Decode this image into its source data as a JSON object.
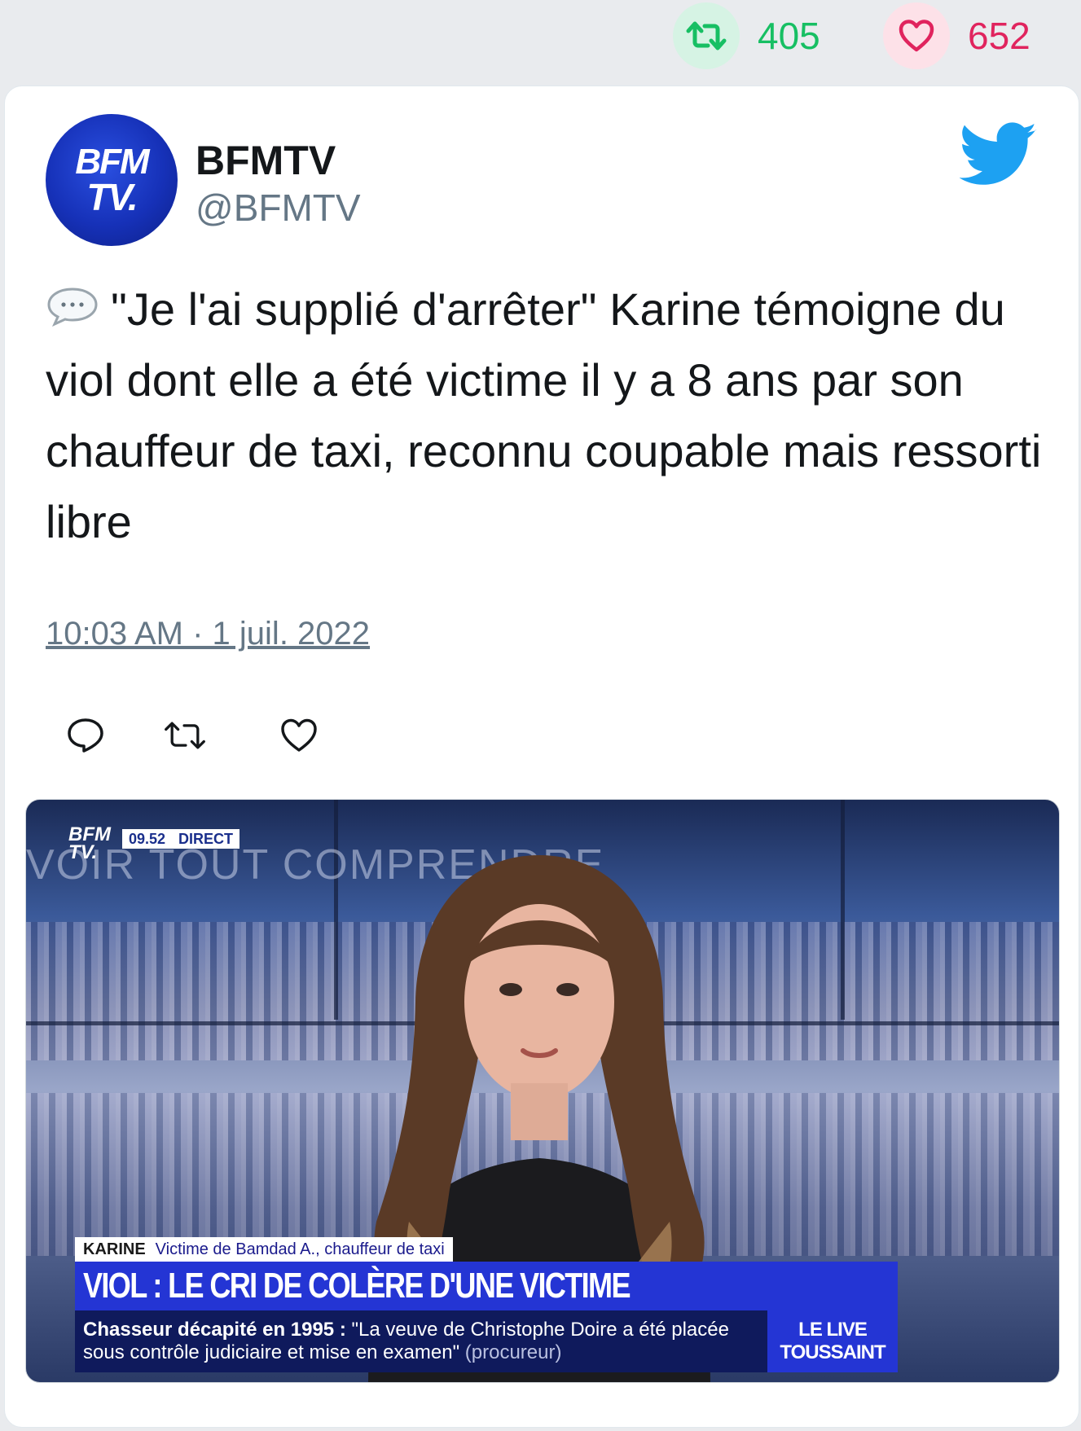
{
  "stats": {
    "retweets": "405",
    "likes": "652",
    "retweet_color": "#17bf63",
    "like_color": "#e0245e"
  },
  "author": {
    "avatar_line1": "BFM",
    "avatar_line2": "TV.",
    "name": "BFMTV",
    "handle": "@BFMTV"
  },
  "tweet": {
    "icon": "speech-balloon-icon",
    "text": "\"Je l'ai supplié d'arrêter\" Karine témoigne du viol dont elle a été victime il y a 8 ans par son chauffeur de taxi, reconnu coupable mais ressorti libre",
    "timestamp": "10:03 AM · 1 juil. 2022"
  },
  "actions": [
    "reply-icon",
    "retweet-icon",
    "like-icon"
  ],
  "media": {
    "watermark": "VOIR TOUT COMPRENDRE",
    "logo_line1": "BFM",
    "logo_line2": "TV.",
    "time": "09.52",
    "live": "DIRECT",
    "lower_name": "KARINE",
    "lower_role": "Victime de Bamdad A., chauffeur de taxi",
    "headline": "VIOL : LE CRI DE COLÈRE D'UNE VICTIME",
    "ticker_bold": "Chasseur décapité en 1995 :",
    "ticker_text": "\"La veuve de Christophe Doire a été placée sous contrôle judiciaire et mise en examen\"",
    "ticker_source": "(procureur)",
    "show_line1": "LE LIVE",
    "show_line2": "TOUSSAINT"
  }
}
